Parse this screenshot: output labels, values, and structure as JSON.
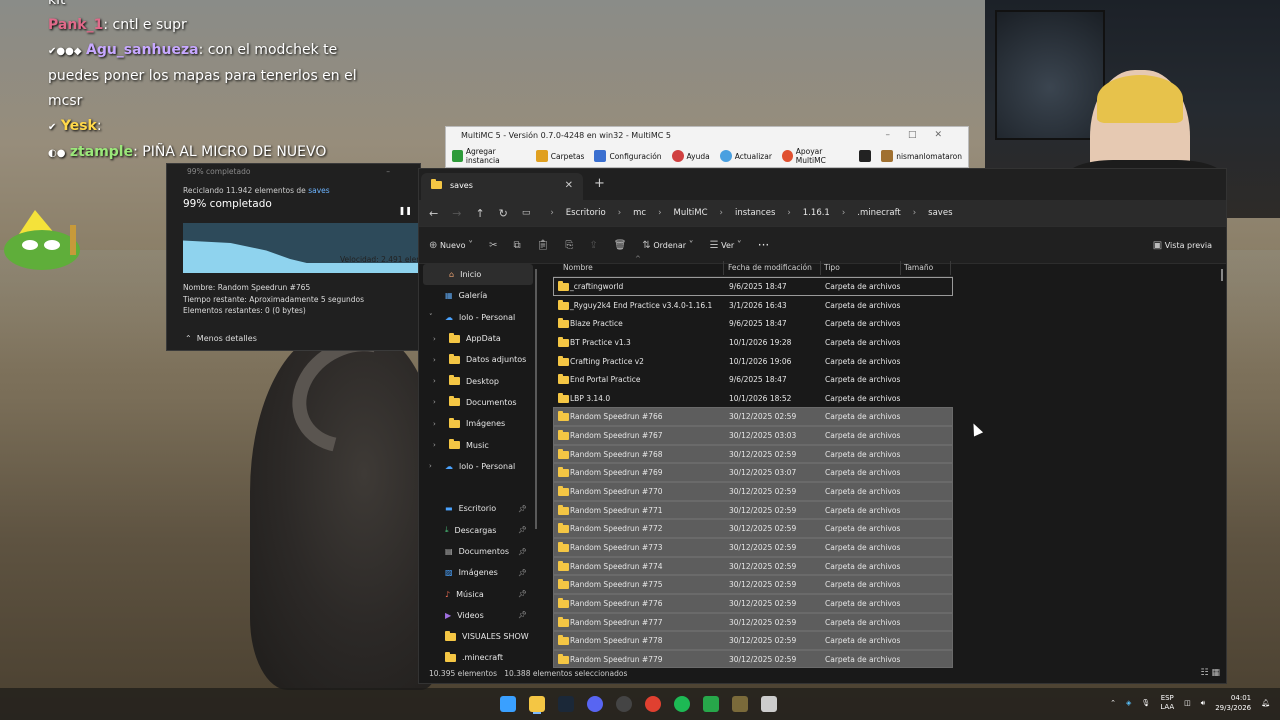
{
  "chat": {
    "line0": "kit",
    "m1_user": "Pank_1",
    "m1_text": ": cntl e supr",
    "m2_user": "Agu_sanhueza",
    "m2_text": ": con el modchek te puedes poner los mapas para tenerlos en el mcsr",
    "m3_user": "Yesk",
    "m3_text": ":",
    "m4_user": "ztample",
    "m4_text": ": PIÑA AL MICRO DE NUEVO"
  },
  "multimc": {
    "title": "MultiMC 5 - Versión 0.7.0-4248 en win32 - MultiMC 5",
    "toolbar": [
      "Agregar instancia",
      "Carpetas",
      "Configuración",
      "Ayuda",
      "Actualizar",
      "Apoyar MultiMC",
      "nismanlomataron"
    ],
    "icon_colors": [
      "#2e9b3a",
      "#e0a020",
      "#3a6fd0",
      "#d04040",
      "#4aa0e0",
      "#e05030",
      "#a07030"
    ]
  },
  "progress": {
    "title": "99% completado",
    "recycling_prefix": "Reciclando 11.942 elementos de",
    "recycling_target": "saves",
    "percent": "99% completado",
    "percent_value": 99,
    "speed": "Velocidad: 2.491 eleme",
    "name": "Nombre: Random Speedrun #765",
    "time_left": "Tiempo restante: Aproximadamente 5 segundos",
    "items_left": "Elementos restantes: 0 (0 bytes)",
    "less_details": "Menos detalles"
  },
  "explorer": {
    "tab_title": "saves",
    "breadcrumbs": [
      "Escritorio",
      "mc",
      "MultiMC",
      "instances",
      "1.16.1",
      ".minecraft",
      "saves"
    ],
    "toolbar": {
      "new": "Nuevo",
      "sort": "Ordenar",
      "view": "Ver",
      "more": "···",
      "preview": "Vista previa"
    },
    "nav": [
      {
        "label": "Inicio",
        "icon": "home-icon",
        "selected": true
      },
      {
        "label": "Galería",
        "icon": "gallery-icon"
      },
      {
        "label": "lolo - Personal",
        "icon": "cloud-icon",
        "expanded": true
      },
      {
        "label": "AppData",
        "icon": "folder-icon",
        "child": true
      },
      {
        "label": "Datos adjuntos",
        "icon": "folder-icon",
        "child": true
      },
      {
        "label": "Desktop",
        "icon": "folder-icon",
        "child": true
      },
      {
        "label": "Documentos",
        "icon": "folder-icon",
        "child": true
      },
      {
        "label": "Imágenes",
        "icon": "folder-icon",
        "child": true
      },
      {
        "label": "Music",
        "icon": "folder-icon",
        "child": true
      },
      {
        "label": "lolo - Personal",
        "icon": "cloud-icon"
      },
      {
        "label": "",
        "icon": ""
      },
      {
        "label": "Escritorio",
        "icon": "desktop-icon",
        "pinned": true
      },
      {
        "label": "Descargas",
        "icon": "download-icon",
        "pinned": true
      },
      {
        "label": "Documentos",
        "icon": "documents-icon",
        "pinned": true
      },
      {
        "label": "Imágenes",
        "icon": "pictures-icon",
        "pinned": true
      },
      {
        "label": "Música",
        "icon": "music-icon",
        "pinned": true
      },
      {
        "label": "Videos",
        "icon": "videos-icon",
        "pinned": true
      },
      {
        "label": "VISUALES SHOW",
        "icon": "folder-icon"
      },
      {
        "label": ".minecraft",
        "icon": "folder-icon"
      }
    ],
    "columns": [
      "Nombre",
      "Fecha de modificación",
      "Tipo",
      "Tamaño"
    ],
    "rows": [
      {
        "name": "_craftingworld",
        "date": "9/6/2025 18:47",
        "type": "Carpeta de archivos",
        "sel": false
      },
      {
        "name": "_Ryguy2k4 End Practice v3.4.0-1.16.1",
        "date": "3/1/2026 16:43",
        "type": "Carpeta de archivos",
        "sel": false
      },
      {
        "name": "Blaze Practice",
        "date": "9/6/2025 18:47",
        "type": "Carpeta de archivos",
        "sel": false
      },
      {
        "name": "BT Practice v1.3",
        "date": "10/1/2026 19:28",
        "type": "Carpeta de archivos",
        "sel": false
      },
      {
        "name": "Crafting Practice v2",
        "date": "10/1/2026 19:06",
        "type": "Carpeta de archivos",
        "sel": false
      },
      {
        "name": "End Portal Practice",
        "date": "9/6/2025 18:47",
        "type": "Carpeta de archivos",
        "sel": false
      },
      {
        "name": "LBP 3.14.0",
        "date": "10/1/2026 18:52",
        "type": "Carpeta de archivos",
        "sel": false
      },
      {
        "name": "Random Speedrun #766",
        "date": "30/12/2025 02:59",
        "type": "Carpeta de archivos",
        "sel": true
      },
      {
        "name": "Random Speedrun #767",
        "date": "30/12/2025 03:03",
        "type": "Carpeta de archivos",
        "sel": true
      },
      {
        "name": "Random Speedrun #768",
        "date": "30/12/2025 02:59",
        "type": "Carpeta de archivos",
        "sel": true
      },
      {
        "name": "Random Speedrun #769",
        "date": "30/12/2025 03:07",
        "type": "Carpeta de archivos",
        "sel": true
      },
      {
        "name": "Random Speedrun #770",
        "date": "30/12/2025 02:59",
        "type": "Carpeta de archivos",
        "sel": true
      },
      {
        "name": "Random Speedrun #771",
        "date": "30/12/2025 02:59",
        "type": "Carpeta de archivos",
        "sel": true
      },
      {
        "name": "Random Speedrun #772",
        "date": "30/12/2025 02:59",
        "type": "Carpeta de archivos",
        "sel": true
      },
      {
        "name": "Random Speedrun #773",
        "date": "30/12/2025 02:59",
        "type": "Carpeta de archivos",
        "sel": true
      },
      {
        "name": "Random Speedrun #774",
        "date": "30/12/2025 02:59",
        "type": "Carpeta de archivos",
        "sel": true
      },
      {
        "name": "Random Speedrun #775",
        "date": "30/12/2025 02:59",
        "type": "Carpeta de archivos",
        "sel": true
      },
      {
        "name": "Random Speedrun #776",
        "date": "30/12/2025 02:59",
        "type": "Carpeta de archivos",
        "sel": true
      },
      {
        "name": "Random Speedrun #777",
        "date": "30/12/2025 02:59",
        "type": "Carpeta de archivos",
        "sel": true
      },
      {
        "name": "Random Speedrun #778",
        "date": "30/12/2025 02:59",
        "type": "Carpeta de archivos",
        "sel": true
      },
      {
        "name": "Random Speedrun #779",
        "date": "30/12/2025 02:59",
        "type": "Carpeta de archivos",
        "sel": true
      }
    ],
    "status_count": "10.395 elementos",
    "status_selected": "10.388 elementos seleccionados"
  },
  "taskbar": {
    "apps": [
      "windows-start-icon",
      "file-explorer-icon",
      "steam-icon",
      "discord-icon",
      "obs-icon",
      "chrome-icon",
      "spotify-icon",
      "minecraft-launcher-icon",
      "multimc-icon",
      "ccleaner-icon"
    ],
    "app_colors": [
      "#3aa0ff",
      "#f4c644",
      "#1b2838",
      "#5865f2",
      "#444444",
      "#e04030",
      "#1db954",
      "#27a74a",
      "#7a6a3a",
      "#cccccc"
    ],
    "lang_top": "ESP",
    "lang_bottom": "LAA",
    "time": "04:01",
    "date": "29/3/2026"
  }
}
